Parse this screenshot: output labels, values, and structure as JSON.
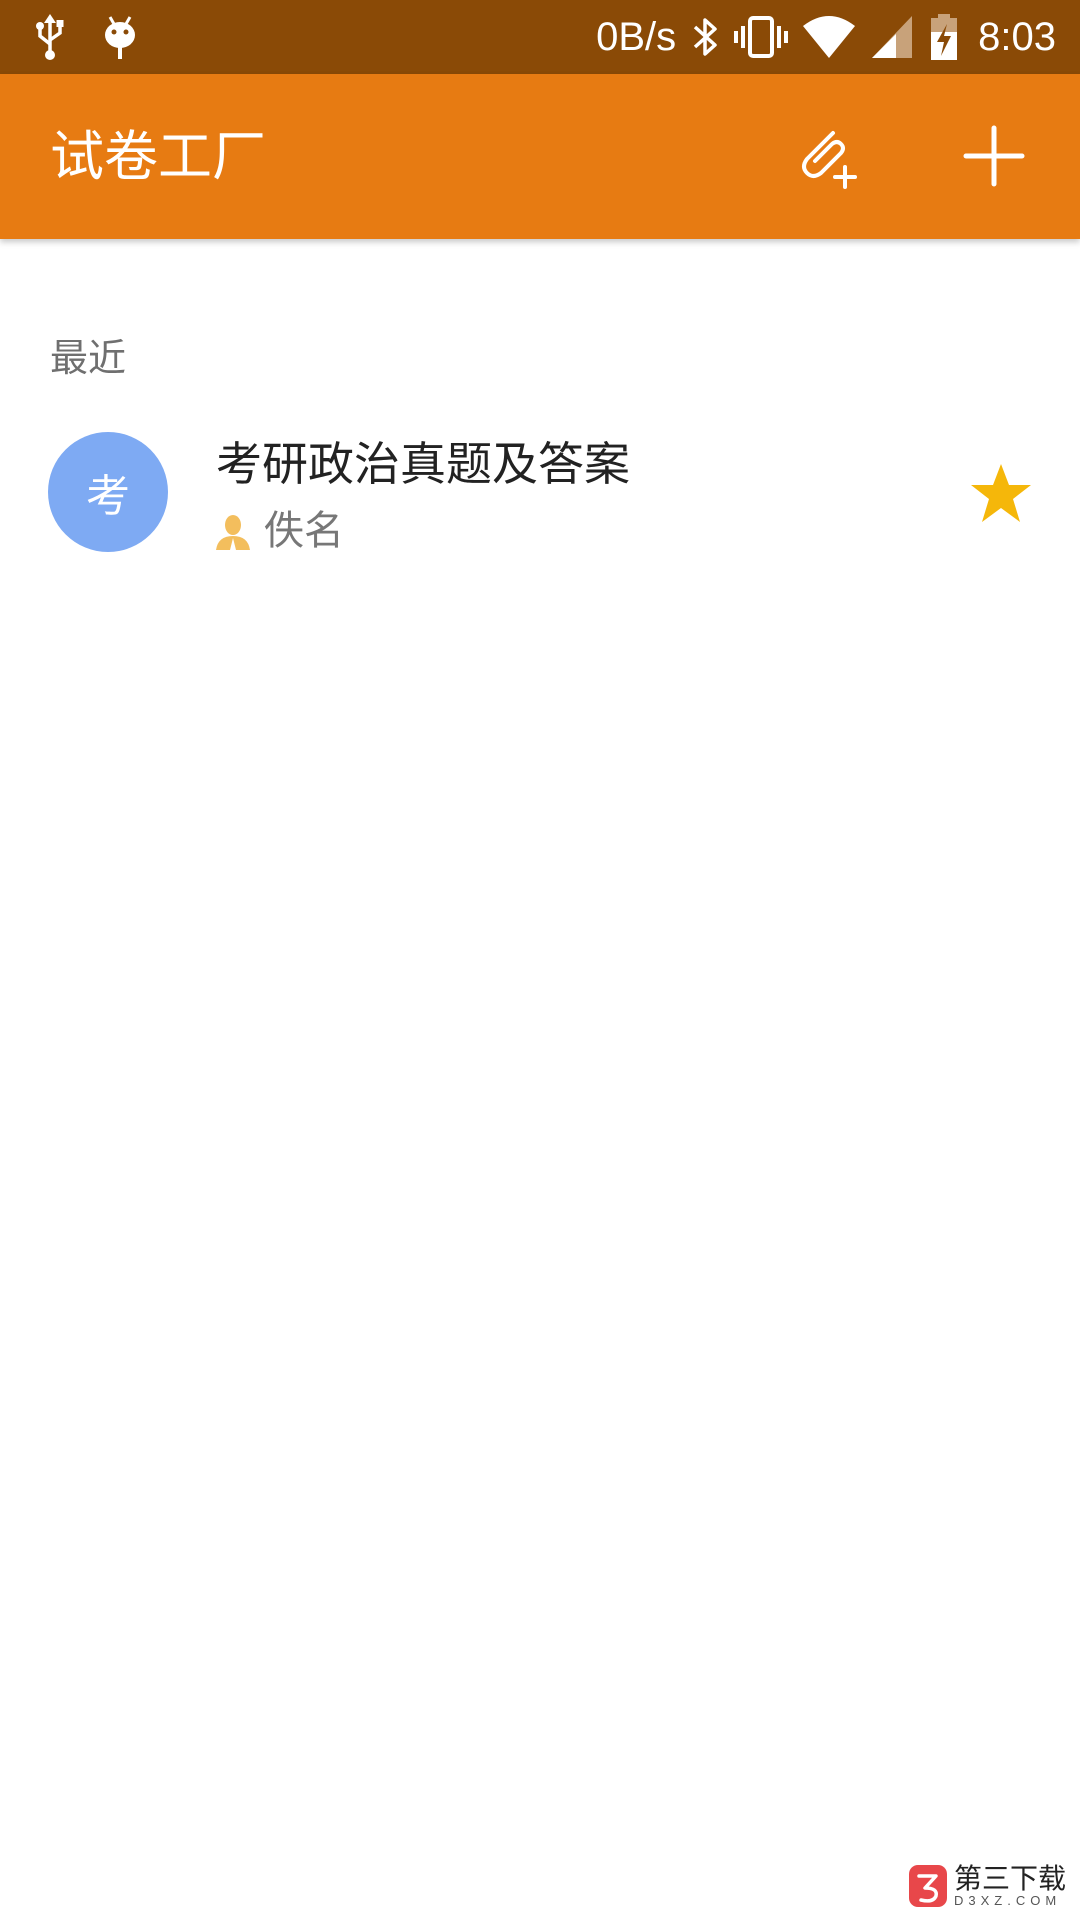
{
  "status_bar": {
    "left_icons": [
      "usb-icon",
      "android-debug-icon"
    ],
    "network_speed": "0B/s",
    "right_icons": [
      "bluetooth-icon",
      "vibrate-icon",
      "wifi-icon",
      "cell-signal-icon",
      "battery-charging-icon"
    ],
    "time": "8:03",
    "background_color": "#8a4a06"
  },
  "app_bar": {
    "title": "试卷工厂",
    "actions": [
      {
        "icon": "attach-add-icon"
      },
      {
        "icon": "plus-icon"
      }
    ],
    "background_color": "#e77b12"
  },
  "recent": {
    "header": "最近",
    "items": [
      {
        "avatar_letter": "考",
        "avatar_color": "#7eaaf3",
        "title": "考研政治真题及答案",
        "author_icon": "person-icon",
        "author": "佚名",
        "starred": true,
        "star_color": "#f5b70a"
      }
    ]
  },
  "watermark": {
    "title": "第三下载",
    "subtitle": "D3XZ.COM",
    "logo_icon": "d3xz-logo-icon"
  }
}
